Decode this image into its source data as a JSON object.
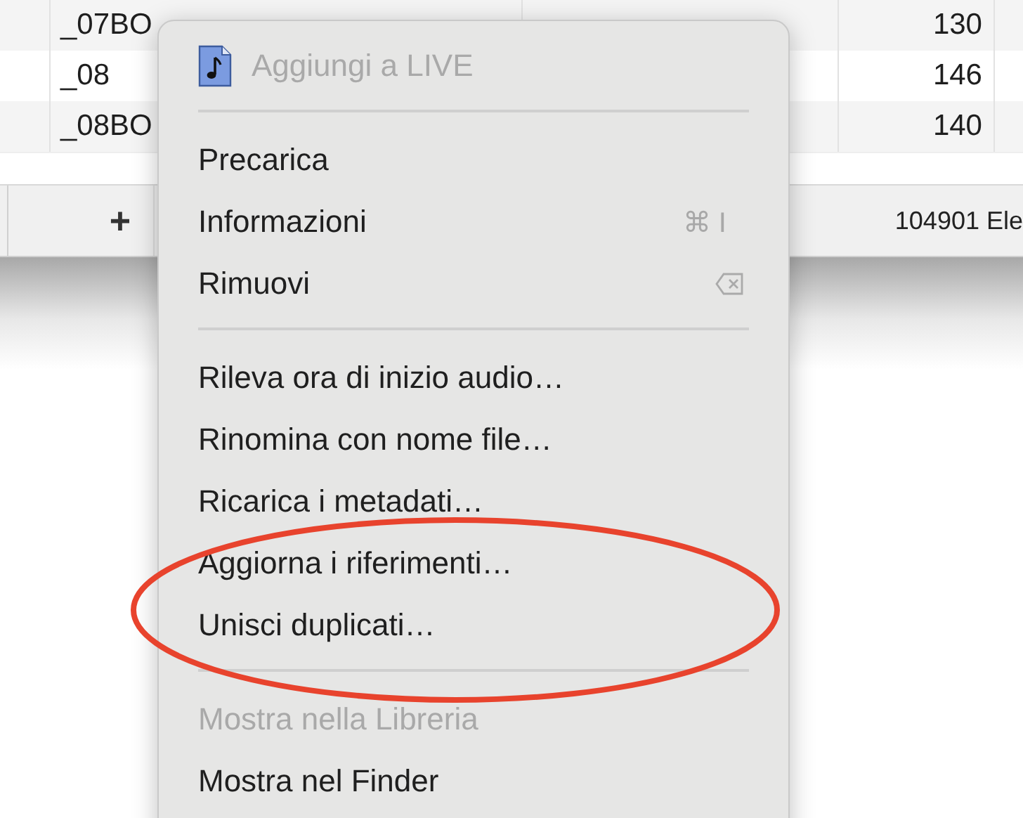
{
  "table": {
    "rows": [
      {
        "column_2": "_07BO",
        "column_4": "130"
      },
      {
        "column_2": "_08",
        "column_4": "146"
      },
      {
        "column_2": "_08BO",
        "column_4": "140"
      }
    ]
  },
  "toolbar": {
    "add_button": "+",
    "status": "104901 Ele"
  },
  "context_menu": {
    "items": [
      {
        "kind": "header",
        "label": "Aggiungi a LIVE",
        "disabled": true
      },
      {
        "kind": "separator"
      },
      {
        "kind": "item",
        "label": "Precarica",
        "disabled": false
      },
      {
        "kind": "item",
        "label": "Informazioni",
        "shortcut": "⌘ I",
        "disabled": false
      },
      {
        "kind": "item",
        "label": "Rimuovi",
        "disabled": false,
        "delete_key_icon": true
      },
      {
        "kind": "separator"
      },
      {
        "kind": "item",
        "label": "Rileva ora di inizio audio…",
        "disabled": false
      },
      {
        "kind": "item",
        "label": "Rinomina con nome file…",
        "disabled": false
      },
      {
        "kind": "item",
        "label": "Ricarica i metadati…",
        "disabled": false
      },
      {
        "kind": "item",
        "label": "Aggiorna i riferimenti…",
        "disabled": false
      },
      {
        "kind": "item",
        "label": "Unisci duplicati…",
        "disabled": false
      },
      {
        "kind": "separator"
      },
      {
        "kind": "item",
        "label": "Mostra nella Libreria",
        "disabled": true
      },
      {
        "kind": "item",
        "label": "Mostra nel Finder",
        "disabled": false
      }
    ]
  },
  "annotation": {
    "kind": "ellipse",
    "color": "#e8432d"
  }
}
